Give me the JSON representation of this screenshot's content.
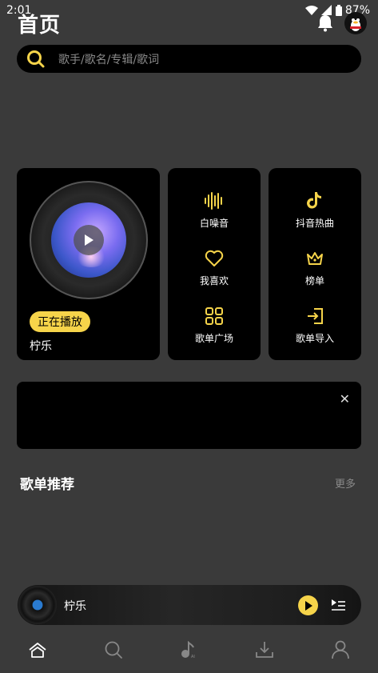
{
  "status": {
    "time": "2:01",
    "battery": "87%"
  },
  "header": {
    "title": "首页"
  },
  "search": {
    "placeholder": "歌手/歌名/专辑/歌词"
  },
  "player_card": {
    "badge": "正在播放",
    "song": "柠乐"
  },
  "features": [
    {
      "label": "白噪音",
      "icon": "waveform-icon"
    },
    {
      "label": "我喜欢",
      "icon": "heart-icon"
    },
    {
      "label": "歌单广场",
      "icon": "grid-icon"
    },
    {
      "label": "抖音热曲",
      "icon": "tiktok-icon"
    },
    {
      "label": "榜单",
      "icon": "crown-icon"
    },
    {
      "label": "歌单导入",
      "icon": "import-icon"
    }
  ],
  "section": {
    "title": "歌单推荐",
    "more": "更多"
  },
  "mini_player": {
    "title": "柠乐"
  },
  "tabs": [
    "home-icon",
    "search-icon",
    "music-note-icon",
    "download-icon",
    "profile-icon"
  ],
  "colors": {
    "accent": "#f6d44a",
    "background": "#3a3a3a",
    "card": "#000000"
  }
}
